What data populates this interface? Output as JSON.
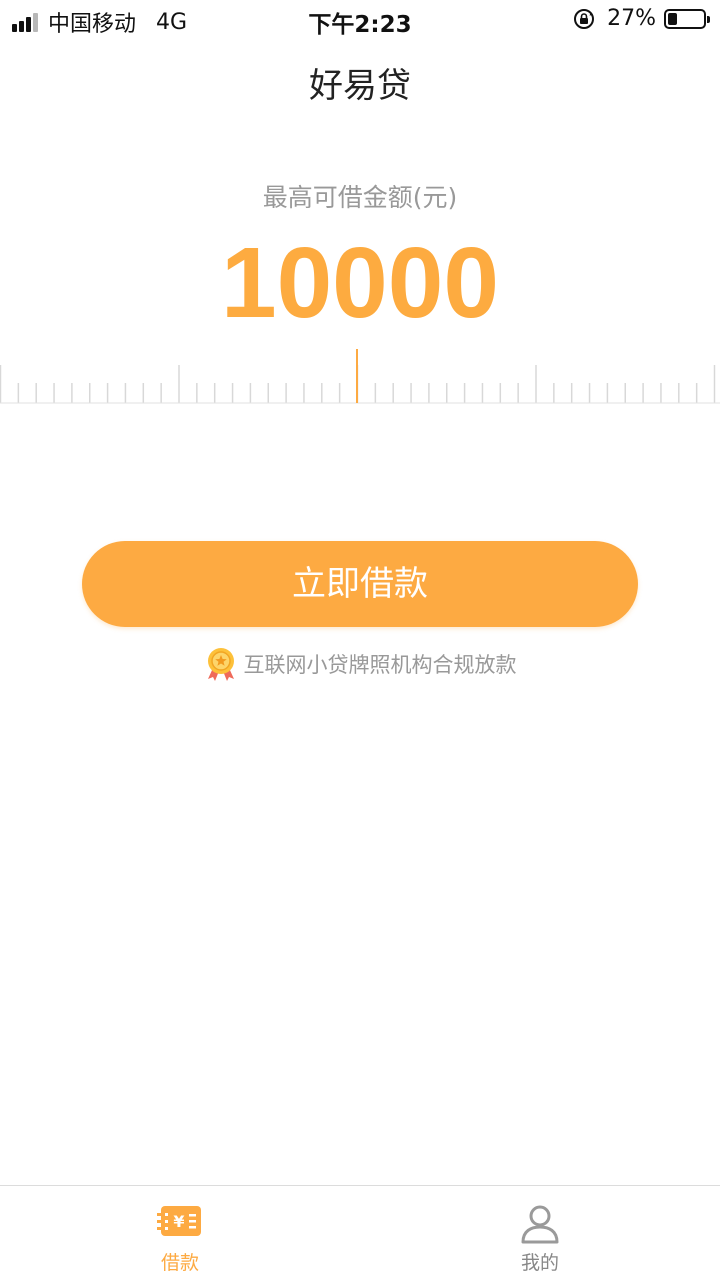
{
  "status_bar": {
    "carrier": "中国移动",
    "network": "4G",
    "time": "下午2:23",
    "battery": "27%",
    "battery_level": 0.27
  },
  "header": {
    "title": "好易贷"
  },
  "amount": {
    "label": "最高可借金额(元)",
    "value": "10000"
  },
  "actions": {
    "borrow_label": "立即借款",
    "license_note": "互联网小贷牌照机构合规放款"
  },
  "tabs": [
    {
      "label": "借款",
      "icon": "loan-icon",
      "active": true
    },
    {
      "label": "我的",
      "icon": "user-icon",
      "active": false
    }
  ],
  "colors": {
    "accent": "#fdaa42",
    "text_muted": "#999999",
    "inactive_tab": "#888888"
  }
}
